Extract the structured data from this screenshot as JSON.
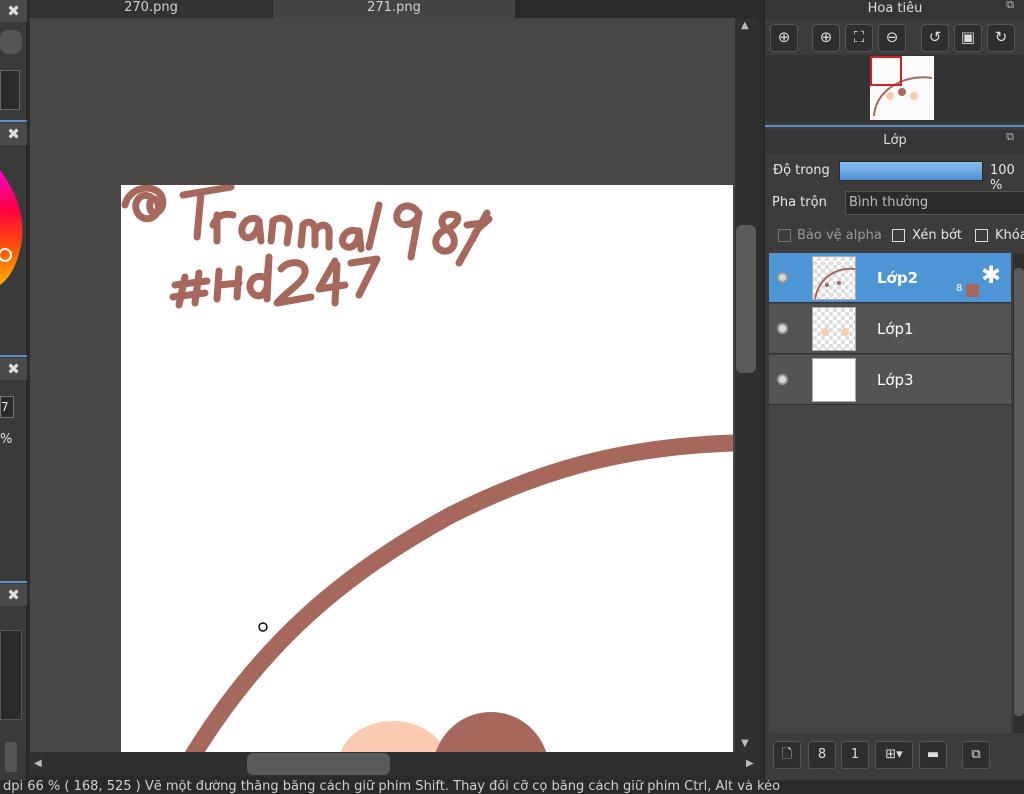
{
  "tabs": [
    {
      "label": "270.png"
    },
    {
      "label": "271.png"
    }
  ],
  "left_panels": {
    "value_fragment": "7",
    "percent_fragment": "%"
  },
  "navigator": {
    "title": "Hoa tiêu",
    "buttons": [
      "zoom-actual",
      "zoom-in",
      "fit-window",
      "zoom-out",
      "rotate-left",
      "fit-screen",
      "rotate-right"
    ]
  },
  "layers_panel": {
    "title": "Lớp",
    "opacity_label": "Độ trong",
    "opacity_value": "100 %",
    "opacity": 100,
    "blend_label": "Pha trộn",
    "blend_value": "Bình thường",
    "protect_alpha_label": "Bảo vệ alpha",
    "clipping_label": "Xén bớt",
    "lock_label": "Khóa",
    "layers": [
      {
        "name": "Lớp2",
        "selected": true,
        "badge": "8",
        "visible": true
      },
      {
        "name": "Lớp1",
        "selected": false,
        "visible": true
      },
      {
        "name": "Lớp3",
        "selected": false,
        "visible": true
      }
    ]
  },
  "canvas": {
    "signature_line1": "@tranma198",
    "signature_line2": "#Hd247",
    "stroke_color": "#a6685c"
  },
  "status": {
    "text": "dpi  66 %   ( 168, 525 )   Vẽ một đường thẳng bằng cách giữ phím Shift. Thay đổi cỡ cọ bằng cách giữ phím Ctrl, Alt và kéo"
  },
  "colors": {
    "accent": "#4d95d4",
    "brush": "#a6685c",
    "canvas_bg": "#484746"
  }
}
